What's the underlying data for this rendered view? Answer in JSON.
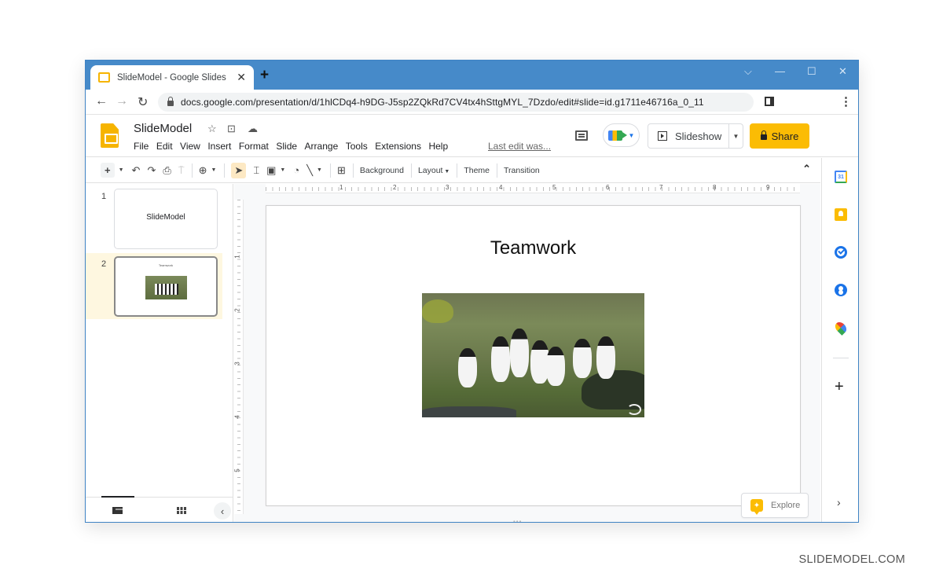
{
  "browser": {
    "tab_title": "SlideModel - Google Slides",
    "new_tab_label": "+",
    "url": "docs.google.com/presentation/d/1hlCDq4-h9DG-J5sp2ZQkRd7CV4tx4hSttgMYL_7Dzdo/edit#slide=id.g1711e46716a_0_11",
    "window_controls": [
      "chevron-down-icon",
      "minimize-icon",
      "maximize-icon",
      "close-icon"
    ]
  },
  "docs": {
    "title": "SlideModel",
    "menu": [
      "File",
      "Edit",
      "View",
      "Insert",
      "Format",
      "Slide",
      "Arrange",
      "Tools",
      "Extensions",
      "Help"
    ],
    "last_edit": "Last edit was...",
    "slideshow_label": "Slideshow",
    "share_label": "Share",
    "accent_color": "#fbbc04"
  },
  "toolbar": {
    "background_label": "Background",
    "layout_label": "Layout",
    "theme_label": "Theme",
    "transition_label": "Transition"
  },
  "ruler": {
    "horizontal": [
      "1",
      "2",
      "3",
      "4",
      "5",
      "6",
      "7",
      "8",
      "9"
    ],
    "vertical": [
      "1",
      "2",
      "3",
      "4",
      "5"
    ]
  },
  "filmstrip": {
    "slides": [
      {
        "number": "1",
        "title": "SlideModel",
        "selected": false
      },
      {
        "number": "2",
        "title": "Teamwork",
        "selected": true
      }
    ]
  },
  "slide": {
    "title": "Teamwork",
    "image_alt": "Group of penguins walking on grassy hillside"
  },
  "explore_label": "Explore",
  "watermark": "SLIDEMODEL.COM"
}
